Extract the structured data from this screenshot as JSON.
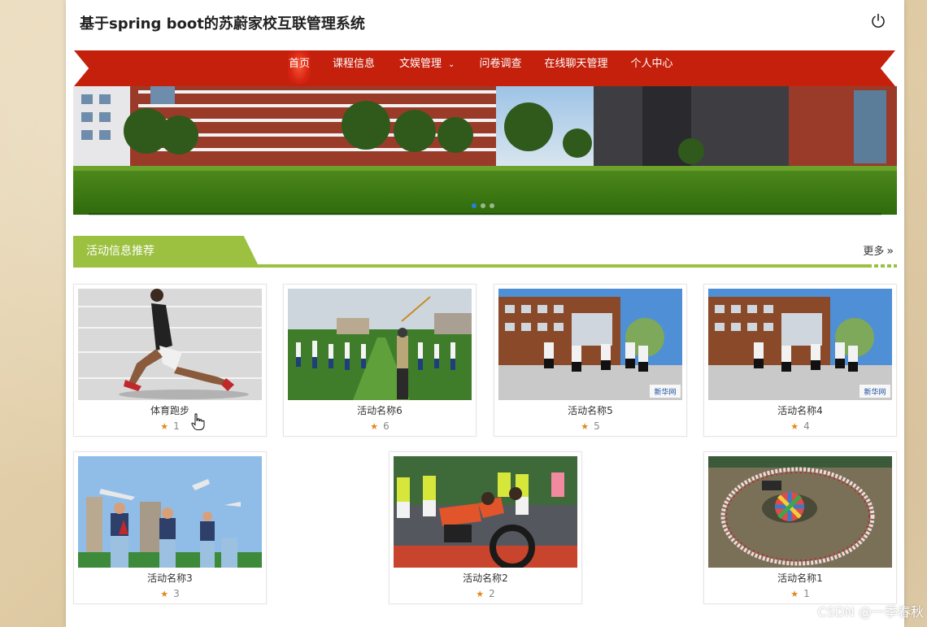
{
  "app": {
    "title": "基于spring boot的苏蔚家校互联管理系统"
  },
  "nav": {
    "items": [
      {
        "label": "首页",
        "active": true
      },
      {
        "label": "课程信息",
        "active": false
      },
      {
        "label": "文娱管理",
        "active": false,
        "has_dropdown": true
      },
      {
        "label": "问卷调查",
        "active": false
      },
      {
        "label": "在线聊天管理",
        "active": false
      },
      {
        "label": "个人中心",
        "active": false
      }
    ],
    "dropdown_icon": "chevron-down-icon"
  },
  "banner": {
    "dots": 3,
    "active_dot": 1
  },
  "section": {
    "title": "活动信息推荐",
    "more_label": "更多",
    "more_icon": "double-chevron-right-icon"
  },
  "cards": [
    {
      "name": "体育跑步",
      "rating": "1"
    },
    {
      "name": "活动名称6",
      "rating": "6"
    },
    {
      "name": "活动名称5",
      "rating": "5"
    },
    {
      "name": "活动名称4",
      "rating": "4"
    },
    {
      "name": "活动名称3",
      "rating": "3"
    },
    {
      "name": "活动名称2",
      "rating": "2"
    },
    {
      "name": "活动名称1",
      "rating": "1"
    }
  ],
  "colors": {
    "nav_red": "#c4200c",
    "section_green": "#9cc040",
    "star_orange": "#e08a1c",
    "active_dot": "#2a7de1"
  },
  "watermark": "CSDN @一季春秋"
}
